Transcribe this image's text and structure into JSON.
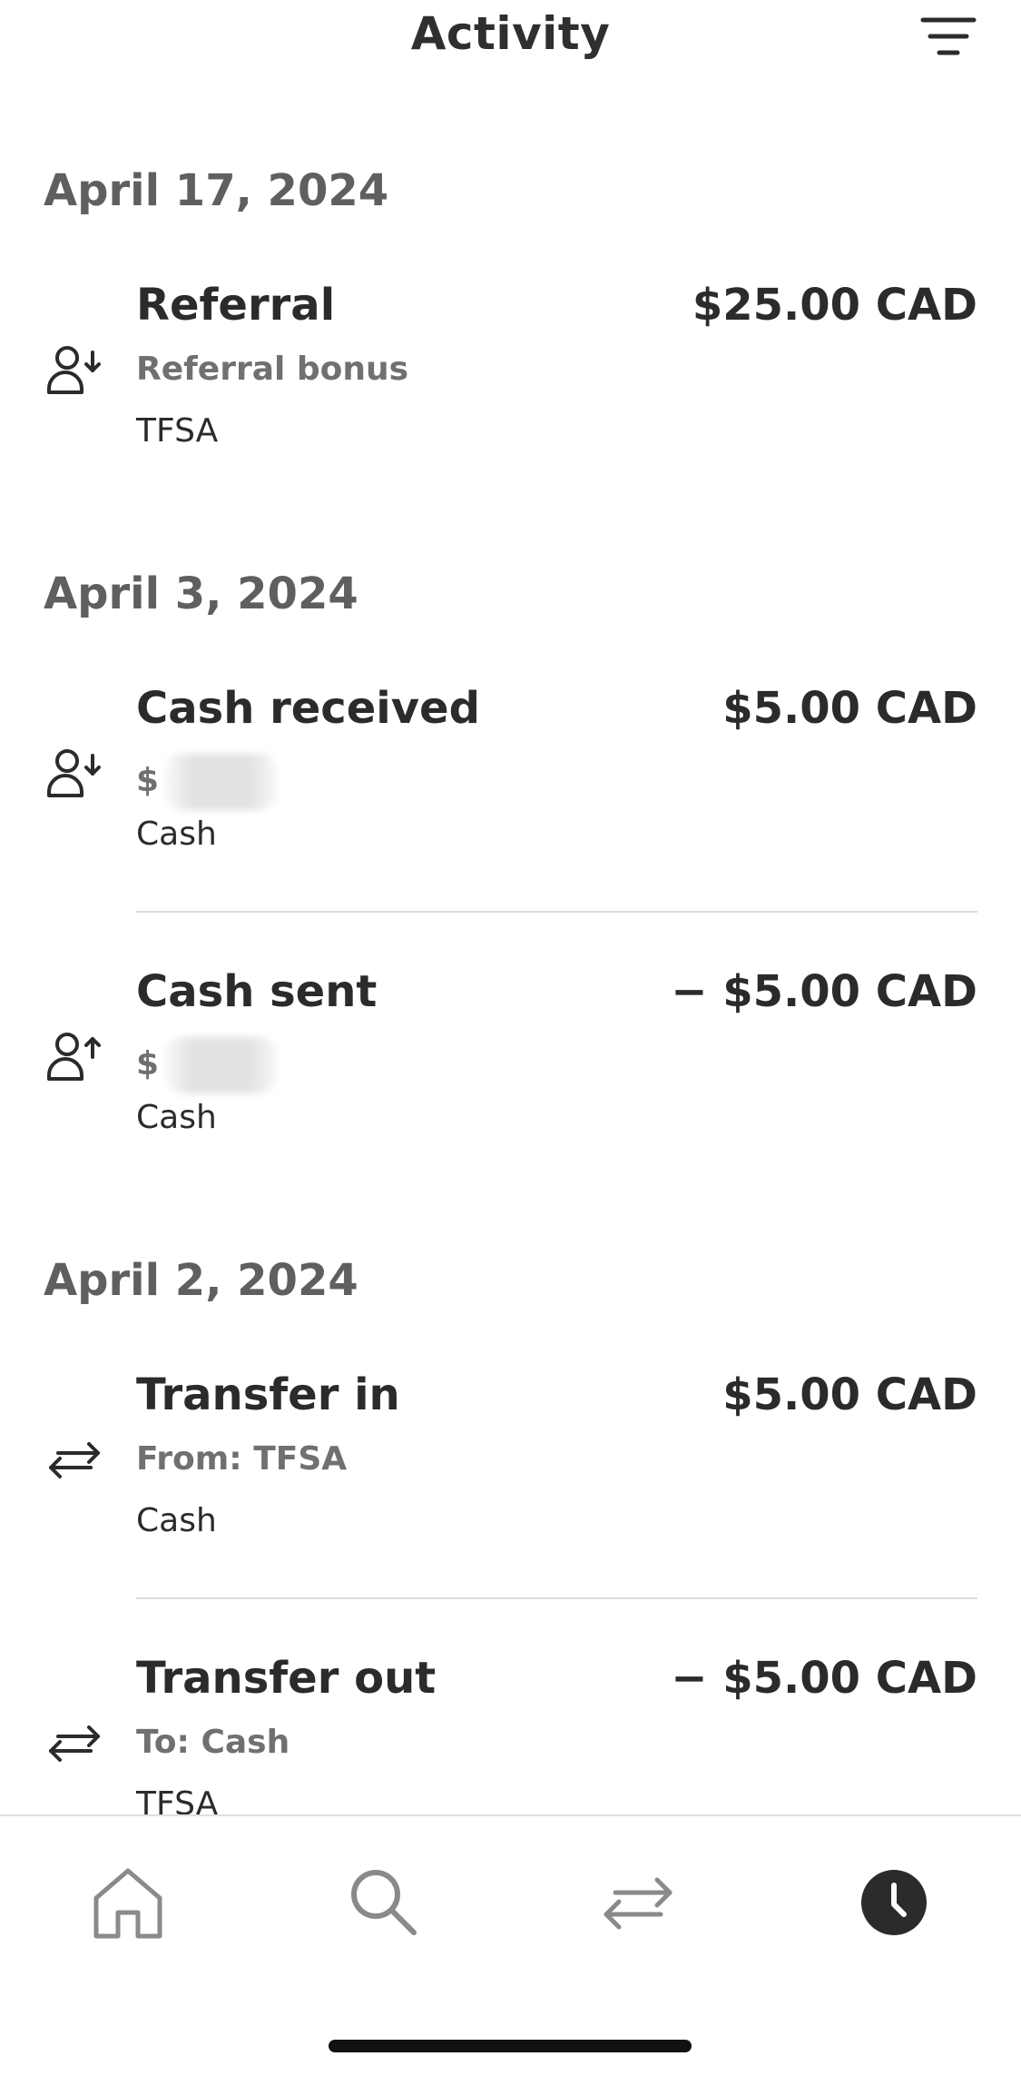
{
  "header": {
    "title": "Activity",
    "filter_icon": "filter-lines-icon"
  },
  "groups": [
    {
      "date": "April 17, 2024",
      "transactions": [
        {
          "icon": "person-arrow-down-icon",
          "title": "Referral",
          "amount": "$25.00 CAD",
          "subtitle": "Referral bonus",
          "account": "TFSA"
        }
      ]
    },
    {
      "date": "April 3, 2024",
      "transactions": [
        {
          "icon": "person-arrow-down-icon",
          "title": "Cash received",
          "amount": "$5.00 CAD",
          "subtitle": "$",
          "account": "Cash"
        },
        {
          "icon": "person-arrow-up-icon",
          "title": "Cash sent",
          "amount": "− $5.00 CAD",
          "subtitle": "$",
          "account": "Cash"
        }
      ]
    },
    {
      "date": "April 2, 2024",
      "transactions": [
        {
          "icon": "transfer-arrows-icon",
          "title": "Transfer in",
          "amount": "$5.00 CAD",
          "subtitle": "From: TFSA",
          "account": "Cash"
        },
        {
          "icon": "transfer-arrows-icon",
          "title": "Transfer out",
          "amount": "− $5.00 CAD",
          "subtitle": "To: Cash",
          "account": "TFSA"
        }
      ]
    }
  ],
  "tabbar": {
    "tabs": [
      {
        "id": "home",
        "icon": "home-icon",
        "active": false
      },
      {
        "id": "search",
        "icon": "search-icon",
        "active": false
      },
      {
        "id": "move",
        "icon": "transfer-arrows-icon",
        "active": false
      },
      {
        "id": "activity",
        "icon": "clock-icon",
        "active": true
      }
    ]
  },
  "colors": {
    "text": "#2b2b2b",
    "date": "#5f5f5f",
    "subtext": "#707070",
    "inactive_tab": "#8a8a8a",
    "divider": "#dcdcdc"
  }
}
